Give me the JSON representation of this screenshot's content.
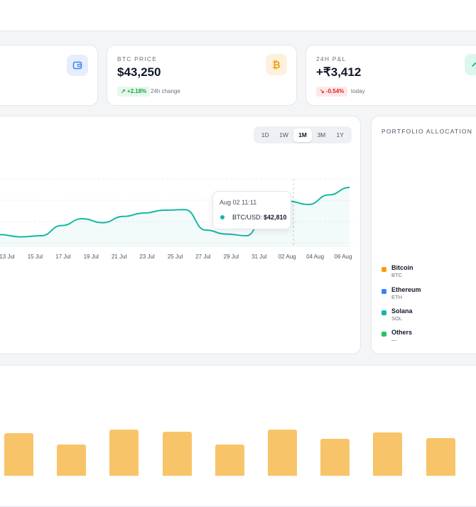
{
  "stats": [
    {
      "label": "BTC PRICE",
      "value": "$43,250",
      "change": "↗ +2.18%",
      "note": "24h change",
      "icon": "bitcoin-icon",
      "icon_glyph": "₿",
      "icon_color": "#f59e0b",
      "icon_bg": "#fdf1de"
    },
    {
      "label": "24H P&L",
      "value": "+₹3,412",
      "change": "↘ -0.54%",
      "note": "today",
      "icon": "trend-up-icon",
      "icon_glyph": "⌃",
      "icon_color": "#10b981",
      "icon_bg": "#dcf7ef"
    }
  ],
  "wallet_icon": {
    "icon": "wallet-icon",
    "color": "#3b82f6",
    "bg": "#e6eefc"
  },
  "colors": {
    "positive": "#16a34a",
    "positive_bg": "#e7f7ed",
    "negative": "#dc2626",
    "negative_bg": "#fde8e8",
    "line": "#14b8a6",
    "bar": "#f8c469"
  },
  "chart": {
    "ranges": [
      "1D",
      "1W",
      "1M",
      "3M",
      "1Y"
    ],
    "active_range": "1M",
    "tooltip": {
      "date": "Aug 02 11:11",
      "label": "BTC/USD:",
      "value": "$42,810"
    }
  },
  "chart_data": [
    {
      "type": "line",
      "x_ticks": [
        "13 Jul",
        "15 Jul",
        "17 Jul",
        "19 Jul",
        "21 Jul",
        "23 Jul",
        "25 Jul",
        "27 Jul",
        "29 Jul",
        "31 Jul",
        "02 Aug",
        "04 Aug",
        "06 Aug"
      ],
      "series": [
        {
          "name": "BTC/USD",
          "values": [
            42220,
            42180,
            42200,
            42380,
            42500,
            42430,
            42540,
            42600,
            42650,
            42660,
            42300,
            42230,
            42200,
            42700,
            42810,
            42750,
            42920,
            43050
          ]
        }
      ]
    },
    {
      "type": "bar",
      "values": [
        60,
        44,
        65,
        62,
        44,
        65,
        52,
        61,
        53
      ]
    }
  ],
  "allocation": {
    "title": "PORTFOLIO ALLOCATION",
    "items": [
      {
        "name": "Bitcoin",
        "symbol": "BTC",
        "color": "#f59e0b"
      },
      {
        "name": "Ethereum",
        "symbol": "ETH",
        "color": "#3b82f6"
      },
      {
        "name": "Solana",
        "symbol": "SOL",
        "color": "#14b8a6"
      },
      {
        "name": "Others",
        "symbol": "—",
        "color": "#22c55e"
      }
    ]
  }
}
